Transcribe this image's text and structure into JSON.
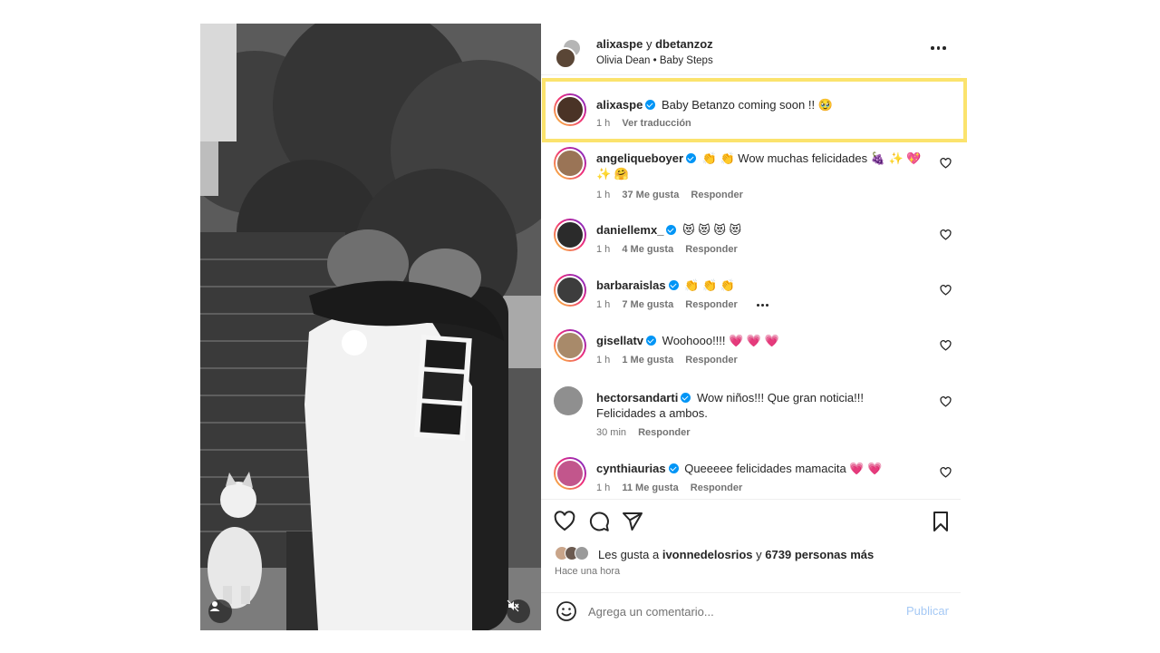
{
  "post": {
    "header": {
      "user1": "alixaspe",
      "conj": "y",
      "user2": "dbetanzoz",
      "song_artist": "Olivia Dean",
      "song_sep": "•",
      "song_title": "Baby Steps"
    },
    "caption": {
      "user": "alixaspe",
      "text": "Baby Betanzo coming soon !! 🥹",
      "time": "1 h",
      "translate": "Ver traducción"
    },
    "comments": [
      {
        "user": "angeliqueboyer",
        "text": "👏 👏 Wow muchas felicidades 🍇 ✨ 💖 ✨ 🤗",
        "time": "1 h",
        "likes": "37 Me gusta",
        "reply": "Responder"
      },
      {
        "user": "daniellemx_",
        "text": "😻 😻 😻 😻",
        "time": "1 h",
        "likes": "4 Me gusta",
        "reply": "Responder"
      },
      {
        "user": "barbaraislas",
        "text": "👏 👏 👏",
        "time": "1 h",
        "likes": "7 Me gusta",
        "reply": "Responder"
      },
      {
        "user": "gisellatv",
        "text": "Woohooo!!!! 💗 💗 💗",
        "time": "1 h",
        "likes": "1 Me gusta",
        "reply": "Responder"
      },
      {
        "user": "hectorsandarti",
        "text": "Wow niños!!! Que gran noticia!!! Felicidades a ambos.",
        "time": "30 min",
        "likes": "",
        "reply": "Responder"
      },
      {
        "user": "cynthiaurias",
        "text": "Queeeee felicidades mamacita 💗 💗",
        "time": "1 h",
        "likes": "11 Me gusta",
        "reply": "Responder"
      }
    ],
    "likes": {
      "prefix": "Les gusta a",
      "user": "ivonnedelosrios",
      "conj": "y",
      "others": "6739 personas más"
    },
    "time_ago": "Hace una hora",
    "add_comment": {
      "placeholder": "Agrega un comentario...",
      "publish": "Publicar"
    }
  },
  "colors": {
    "highlight": "#fbe36d",
    "verified": "#0095f6",
    "publish": "#a5c9f5",
    "muted_text": "#737373"
  },
  "icons": [
    "user-tag-icon",
    "mute-icon",
    "more-options-icon",
    "heart-icon",
    "comment-icon",
    "share-icon",
    "bookmark-icon",
    "emoji-icon",
    "verified-badge-icon"
  ]
}
